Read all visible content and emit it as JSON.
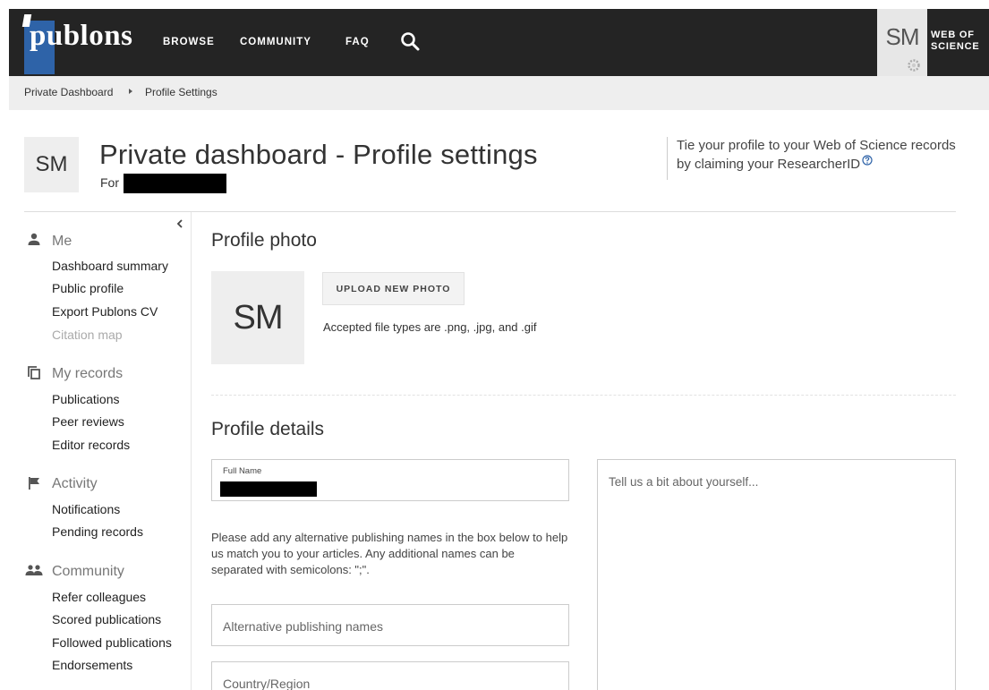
{
  "nav": {
    "logo": "publons",
    "browse": "BROWSE",
    "community": "COMMUNITY",
    "faq": "FAQ",
    "avatar_initials": "SM",
    "web_of_science": "WEB OF\nSCIENCE"
  },
  "breadcrumb": {
    "item1": "Private Dashboard",
    "item2": "Profile Settings"
  },
  "header": {
    "avatar_initials": "SM",
    "title": "Private dashboard - Profile settings",
    "for_label": "For",
    "tie_text": "Tie your profile to your Web of Science records by claiming your ResearcherID"
  },
  "sidebar": {
    "sections": [
      {
        "label": "Me",
        "icon": "person-icon",
        "items": [
          {
            "label": "Dashboard summary"
          },
          {
            "label": "Public profile"
          },
          {
            "label": "Export Publons CV"
          },
          {
            "label": "Citation map"
          }
        ]
      },
      {
        "label": "My records",
        "icon": "records-icon",
        "items": [
          {
            "label": "Publications"
          },
          {
            "label": "Peer reviews"
          },
          {
            "label": "Editor records"
          }
        ]
      },
      {
        "label": "Activity",
        "icon": "flag-icon",
        "items": [
          {
            "label": "Notifications"
          },
          {
            "label": "Pending records"
          }
        ]
      },
      {
        "label": "Community",
        "icon": "group-icon",
        "items": [
          {
            "label": "Refer colleagues"
          },
          {
            "label": "Scored publications"
          },
          {
            "label": "Followed publications"
          },
          {
            "label": "Endorsements"
          }
        ]
      }
    ]
  },
  "profile_photo": {
    "heading": "Profile photo",
    "avatar_initials": "SM",
    "upload_label": "UPLOAD NEW PHOTO",
    "accepted_text": "Accepted file types are .png, .jpg, and .gif"
  },
  "profile_details": {
    "heading": "Profile details",
    "full_name_label": "Full Name",
    "help_text": "Please add any alternative publishing names in the box below to help us match you to your articles. Any additional names can be separated with semicolons: \";\".",
    "alt_names_placeholder": "Alternative publishing names",
    "country_placeholder": "Country/Region",
    "bio_placeholder": "Tell us a bit about yourself..."
  }
}
